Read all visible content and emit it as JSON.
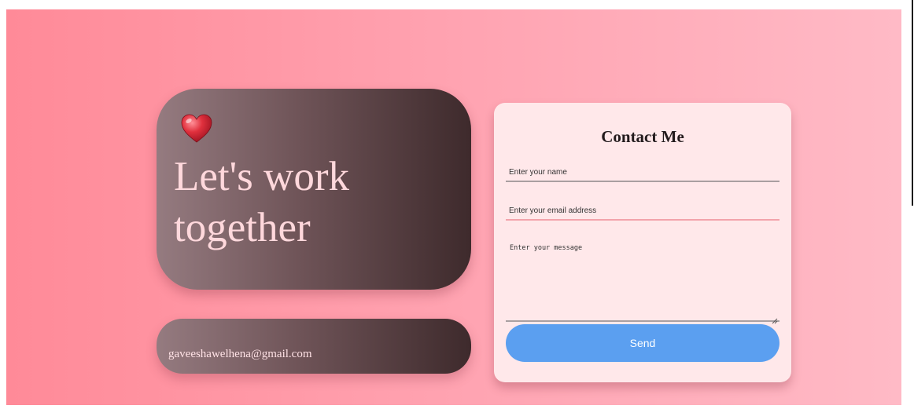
{
  "hero": {
    "icon": "heart-icon",
    "title": "Let's work\ntogether"
  },
  "contact_email": {
    "text": "gaveeshawelhena@gmail.com"
  },
  "contact_form": {
    "title": "Contact Me",
    "name_placeholder": "Enter your name",
    "email_placeholder": "Enter your email address",
    "message_placeholder": "Enter your message",
    "send_label": "Send"
  },
  "colors": {
    "background_start": "#ff8a98",
    "background_end": "#ffbac6",
    "card_gradient_start": "#957b80",
    "card_gradient_end": "#3e2a2c",
    "form_background": "#ffe8ea",
    "send_button": "#5b9ff0",
    "heart": "#e0303d"
  }
}
